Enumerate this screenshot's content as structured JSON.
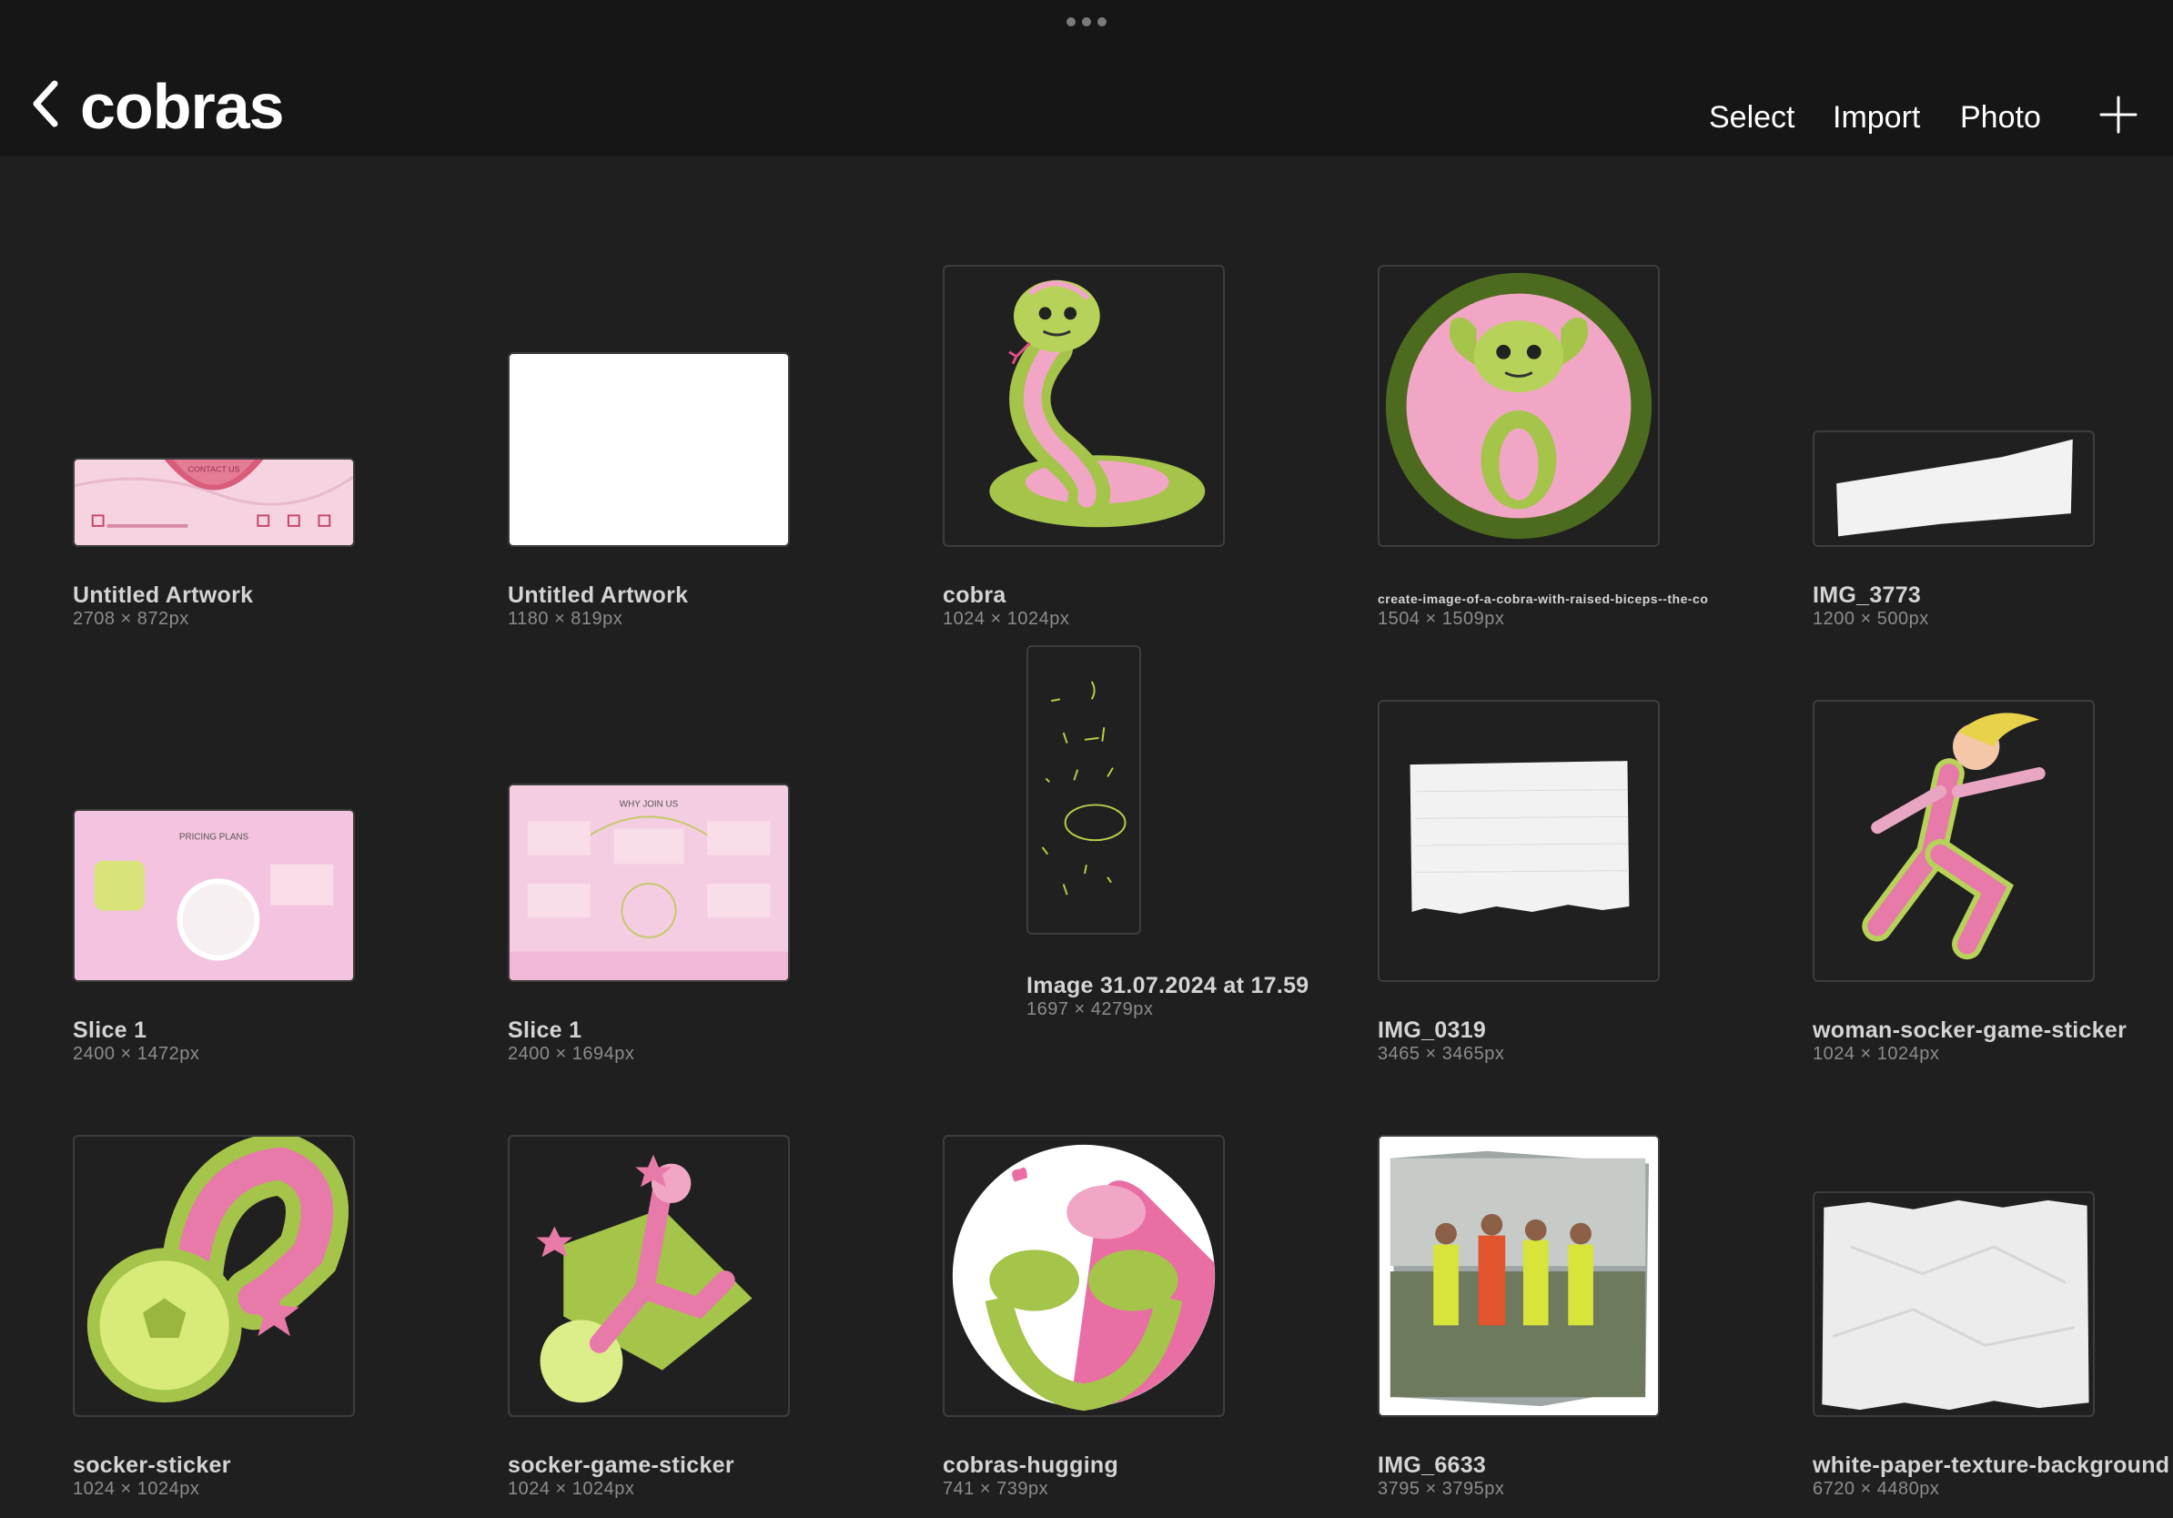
{
  "header": {
    "title": "cobras",
    "actions": {
      "select": "Select",
      "import": "Import",
      "photo": "Photo"
    }
  },
  "icons": {
    "back": "chevron-left-icon",
    "add": "plus-icon",
    "handle": "more-dots-icon"
  },
  "colors": {
    "background": "#1f1f1f",
    "topbar": "#161616",
    "pink": "#f2a3c8",
    "green": "#a7c84a"
  },
  "artworks": [
    {
      "name": "Untitled Artwork",
      "dims": "2708 × 872px"
    },
    {
      "name": "Untitled Artwork",
      "dims": "1180 × 819px"
    },
    {
      "name": "cobra",
      "dims": "1024 × 1024px"
    },
    {
      "name": "create-image-of-a-cobra-with-raised-biceps--the-co",
      "dims": "1504 × 1509px"
    },
    {
      "name": "IMG_3773",
      "dims": "1200 × 500px"
    },
    {
      "name": "Slice 1",
      "dims": "2400 × 1472px"
    },
    {
      "name": "Slice 1",
      "dims": "2400 × 1694px"
    },
    {
      "name": "Image 31.07.2024 at 17.59",
      "dims": "1697 × 4279px"
    },
    {
      "name": "IMG_0319",
      "dims": "3465 × 3465px"
    },
    {
      "name": "woman-socker-game-sticker",
      "dims": "1024 × 1024px"
    },
    {
      "name": "socker-sticker",
      "dims": "1024 × 1024px"
    },
    {
      "name": "socker-game-sticker",
      "dims": "1024 × 1024px"
    },
    {
      "name": "cobras-hugging",
      "dims": "741 × 739px"
    },
    {
      "name": "IMG_6633",
      "dims": "3795 × 3795px"
    },
    {
      "name": "white-paper-texture-background",
      "dims": "6720 × 4480px"
    }
  ],
  "thumb_text": {
    "contact": "CONTACT US",
    "pricing": "PRICING PLANS",
    "why": "WHY JOIN US"
  }
}
